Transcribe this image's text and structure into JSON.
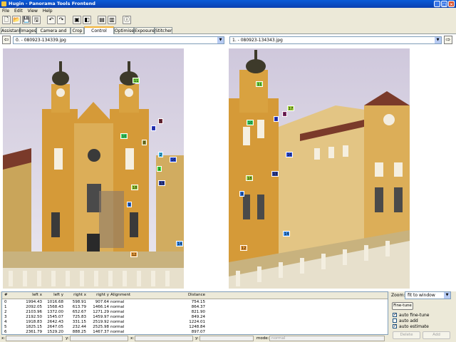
{
  "window": {
    "title": "Hugin - Panorama Tools Frontend"
  },
  "menu": [
    "File",
    "Edit",
    "View",
    "Help"
  ],
  "tabs": [
    "Assistant",
    "Images",
    "Camera and Lens",
    "Crop",
    "Control Points",
    "Optimiser",
    "Exposure",
    "Stitcher"
  ],
  "active_tab": "Control Points",
  "left_image": {
    "label": "0. - 080923-134339.jpg"
  },
  "right_image": {
    "label": "1. - 080923-134343.jpg"
  },
  "table": {
    "headers": [
      "#",
      "left x",
      "left y",
      "right x",
      "right y",
      "Alignment",
      "Distance"
    ],
    "rows": [
      [
        "0",
        "1994.43",
        "1016.68",
        "598.91",
        "907.64",
        "normal",
        "754.15"
      ],
      [
        "1",
        "2092.05",
        "1568.43",
        "613.79",
        "1466.14",
        "normal",
        "864.37"
      ],
      [
        "2",
        "2103.96",
        "1372.00",
        "652.67",
        "1271.29",
        "normal",
        "821.90"
      ],
      [
        "3",
        "2192.50",
        "1545.07",
        "725.83",
        "1459.97",
        "normal",
        "849.24"
      ],
      [
        "4",
        "1918.83",
        "2642.43",
        "331.15",
        "2519.92",
        "normal",
        "1224.01"
      ],
      [
        "5",
        "1825.15",
        "2647.05",
        "232.44",
        "2525.98",
        "normal",
        "1248.84"
      ],
      [
        "6",
        "2361.79",
        "1529.20",
        "888.25",
        "1467.37",
        "normal",
        "897.07"
      ]
    ]
  },
  "zoom": {
    "label": "Zoom:",
    "value": "fit to window"
  },
  "finetune_label": "Fine-tune",
  "checks": [
    {
      "label": "auto fine-tune",
      "checked": true
    },
    {
      "label": "auto add",
      "checked": false
    },
    {
      "label": "auto estimate",
      "checked": true
    }
  ],
  "delete_label": "Delete",
  "add_label": "Add",
  "status": {
    "x_label": "x:",
    "y_label": "y:",
    "x2_label": "x:",
    "y2_label": "y:",
    "mode_label": "mode:",
    "mode_value": "normal"
  },
  "left_points": [
    {
      "n": "11",
      "c": "#7ad84a"
    },
    {
      "n": "0",
      "c": "#2f3fd6"
    },
    {
      "n": "5",
      "c": "#7a2e3e"
    },
    {
      "n": "10",
      "c": "#3fd86a"
    },
    {
      "n": "8",
      "c": "#9a9a3a"
    },
    {
      "n": "2",
      "c": "#3fb6e8"
    },
    {
      "n": "16",
      "c": "#2f4fd6"
    },
    {
      "n": "1",
      "c": "#3fd83f"
    },
    {
      "n": "18",
      "c": "#a0d040"
    },
    {
      "n": "13",
      "c": "#2f3f9a"
    },
    {
      "n": "9",
      "c": "#2f6fd6"
    },
    {
      "n": "12",
      "c": "#e89a3a"
    },
    {
      "n": "14",
      "c": "#3f8fe8"
    }
  ],
  "right_points": [
    {
      "n": "11",
      "c": "#7ad84a"
    },
    {
      "n": "17",
      "c": "#a0d040"
    },
    {
      "n": "6",
      "c": "#8a2e6e"
    },
    {
      "n": "0",
      "c": "#2f3fd6"
    },
    {
      "n": "10",
      "c": "#3fd86a"
    },
    {
      "n": "16",
      "c": "#2f4fd6"
    },
    {
      "n": "13",
      "c": "#2f3f9a"
    },
    {
      "n": "18",
      "c": "#a0d040"
    },
    {
      "n": "9",
      "c": "#2f6fd6"
    },
    {
      "n": "14",
      "c": "#3f8fe8"
    },
    {
      "n": "12",
      "c": "#e89a3a"
    }
  ]
}
